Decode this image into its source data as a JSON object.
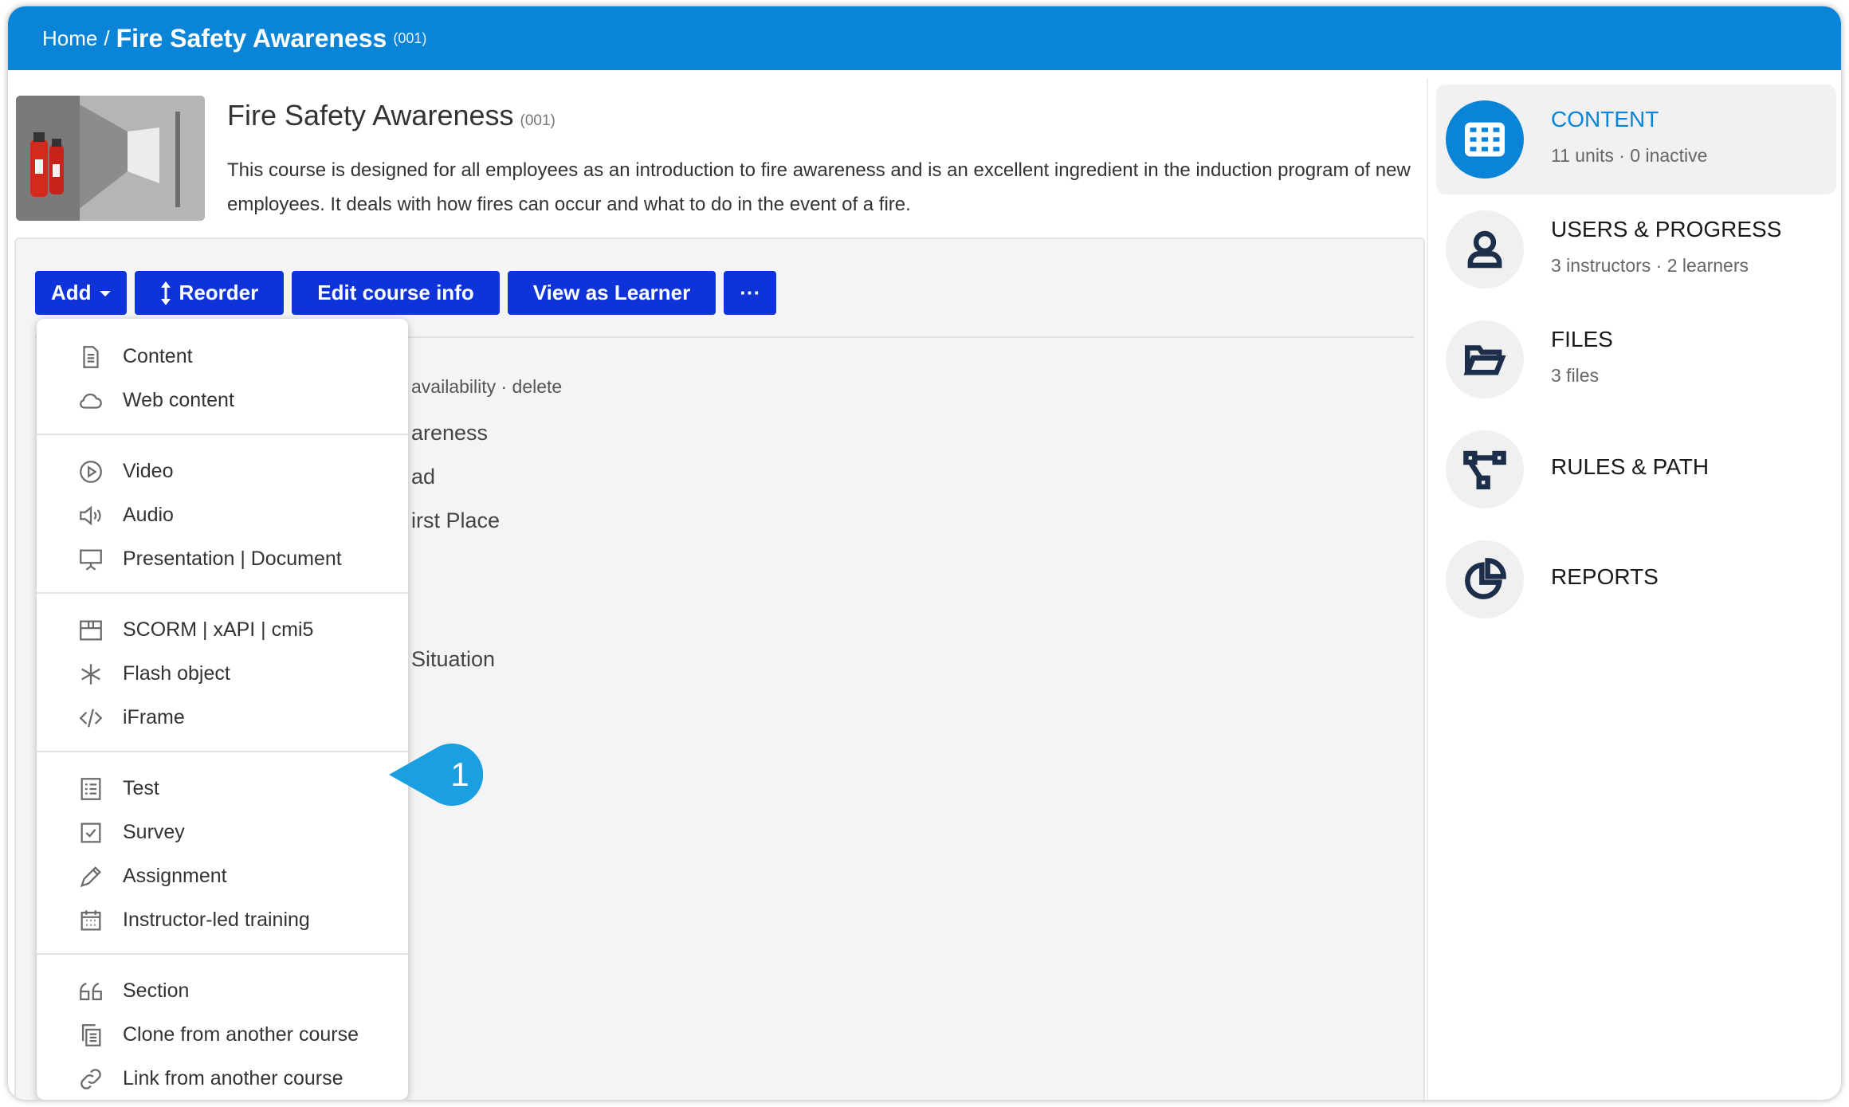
{
  "breadcrumb": {
    "home": "Home",
    "separator": "/",
    "title": "Fire Safety Awareness",
    "code": "(001)"
  },
  "course": {
    "title": "Fire Safety Awareness",
    "code": "(001)",
    "description": "This course is designed for all employees as an introduction to fire awareness and is an excellent ingredient in the induction program of new employees. It deals with how fires can occur and what to do in the event of a fire."
  },
  "toolbar": {
    "add_label": "Add",
    "reorder_label": "Reorder",
    "edit_label": "Edit course info",
    "view_label": "View as Learner",
    "more_label": "···"
  },
  "background_content": {
    "meta": "availability · delete",
    "line1": "areness",
    "line2": "ad",
    "line3": "irst Place",
    "line4": "Situation"
  },
  "add_menu": {
    "groups": [
      [
        {
          "label": "Content",
          "icon": "document-icon"
        },
        {
          "label": "Web content",
          "icon": "cloud-icon"
        }
      ],
      [
        {
          "label": "Video",
          "icon": "play-circle-icon"
        },
        {
          "label": "Audio",
          "icon": "speaker-icon"
        },
        {
          "label": "Presentation | Document",
          "icon": "presentation-icon"
        }
      ],
      [
        {
          "label": "SCORM | xAPI | cmi5",
          "icon": "package-icon"
        },
        {
          "label": "Flash object",
          "icon": "asterisk-icon"
        },
        {
          "label": "iFrame",
          "icon": "code-icon"
        }
      ],
      [
        {
          "label": "Test",
          "icon": "checklist-icon"
        },
        {
          "label": "Survey",
          "icon": "checkbox-icon"
        },
        {
          "label": "Assignment",
          "icon": "pencil-icon"
        },
        {
          "label": "Instructor-led training",
          "icon": "calendar-icon"
        }
      ],
      [
        {
          "label": "Section",
          "icon": "quote-icon"
        },
        {
          "label": "Clone from another course",
          "icon": "clone-icon"
        },
        {
          "label": "Link from another course",
          "icon": "link-icon"
        }
      ]
    ]
  },
  "callout": {
    "number": "1",
    "color": "#1a9fe0"
  },
  "sidebar": {
    "items": [
      {
        "title": "CONTENT",
        "subtitle": "11 units · 0 inactive",
        "icon": "grid-icon",
        "active": true
      },
      {
        "title": "USERS & PROGRESS",
        "subtitle": "3 instructors · 2 learners",
        "icon": "user-icon"
      },
      {
        "title": "FILES",
        "subtitle": "3 files",
        "icon": "folder-icon"
      },
      {
        "title": "RULES & PATH",
        "subtitle": "",
        "icon": "flow-icon"
      },
      {
        "title": "REPORTS",
        "subtitle": "",
        "icon": "pie-chart-icon"
      }
    ]
  },
  "colors": {
    "topbar": "#0a84d6",
    "button": "#0e33d8",
    "accent": "#0a84d6"
  }
}
